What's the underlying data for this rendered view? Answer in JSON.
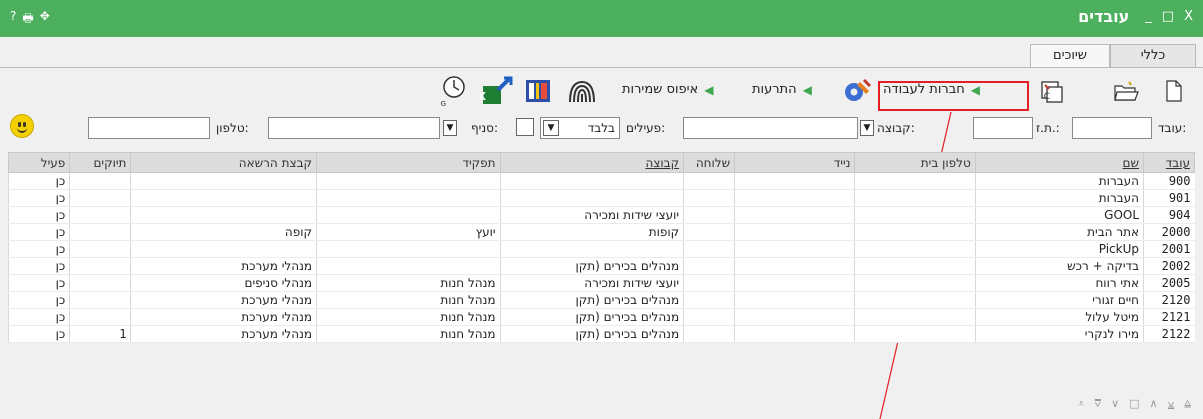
{
  "window": {
    "title": "עובדים",
    "left_controls": [
      "?",
      "🖶",
      "✥"
    ],
    "right_controls": [
      "_",
      "□",
      "X"
    ]
  },
  "tabs": [
    {
      "label": "כללי",
      "active": false
    },
    {
      "label": "שיוכים",
      "active": true
    }
  ],
  "toolbar": {
    "companies_label": "חברות לעבודה",
    "alerts_label": "התרעות",
    "reset_label": "איפוס שמירות"
  },
  "filters": {
    "employee_label": "עובד:",
    "id_label": "ת.ז.:",
    "group_label": "קבוצה:",
    "active_label": "פעילים:",
    "active_value": "בלבד",
    "branch_label": "סניף:",
    "phone_label": "טלפון:"
  },
  "table": {
    "columns": [
      "עובד",
      "שם",
      "טלפון בית",
      "נייד",
      "שלוחה",
      "קבוצה",
      "תפקיד",
      "קבצת הרשאה",
      "תיוקים",
      "פעיל"
    ],
    "rows": [
      [
        "900",
        "העברות",
        "",
        "",
        "",
        "",
        "",
        "",
        "",
        "כן"
      ],
      [
        "901",
        "העברות",
        "",
        "",
        "",
        "",
        "",
        "",
        "",
        "כן"
      ],
      [
        "904",
        "GOOL",
        "",
        "",
        "",
        "יועצי שידות ומכירה",
        "",
        "",
        "",
        "כן"
      ],
      [
        "2000",
        "אתר הבית",
        "",
        "",
        "",
        "קופות",
        "יועץ",
        "קופה",
        "",
        "כן"
      ],
      [
        "2001",
        "PickUp",
        "",
        "",
        "",
        "",
        "",
        "",
        "",
        "כן"
      ],
      [
        "2002",
        "בדיקה + רכש",
        "",
        "",
        "",
        "מנהלים בכירים (תקן",
        "",
        "מנהלי מערכת",
        "",
        "כן"
      ],
      [
        "2005",
        "אתי רווח",
        "",
        "",
        "",
        "יועצי שידות ומכירה",
        "מנהל חנות",
        "מנהלי סניפים",
        "",
        "כן"
      ],
      [
        "2120",
        "חיים זגורי",
        "",
        "",
        "",
        "מנהלים בכירים (תקן",
        "מנהל חנות",
        "מנהלי מערכת",
        "",
        "כן"
      ],
      [
        "2121",
        "מיטל עלול",
        "",
        "",
        "",
        "מנהלים בכירים (תקן",
        "מנהל חנות",
        "מנהלי מערכת",
        "",
        "כן"
      ],
      [
        "2122",
        "מירו לנקרי",
        "",
        "",
        "",
        "מנהלים בכירים (תקן",
        "מנהל חנות",
        "מנהלי מערכת",
        "1",
        "כן"
      ]
    ]
  },
  "bottom_icons": [
    "first-icon",
    "prev-page-icon",
    "down-icon",
    "square-icon",
    "up-icon",
    "next-page-icon",
    "last-icon"
  ],
  "colors": {
    "titlebar": "#4db05e",
    "highlight": "#e31e24"
  }
}
